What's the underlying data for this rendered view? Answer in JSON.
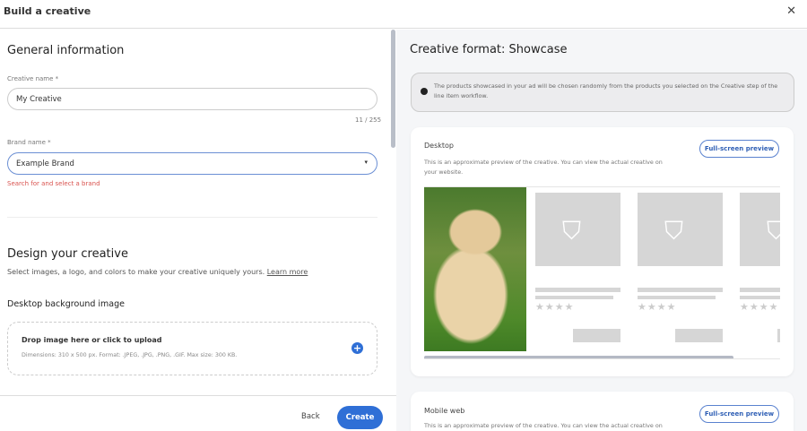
{
  "header": {
    "title": "Build a creative",
    "close_icon": "close-icon"
  },
  "general": {
    "title": "General information",
    "creative_name_label": "Creative name *",
    "creative_name_value": "My Creative",
    "char_count": "11 / 255",
    "brand_name_label": "Brand name *",
    "brand_name_value": "Example Brand",
    "brand_error": "Search for and select a brand"
  },
  "design": {
    "title": "Design your creative",
    "description": "Select images, a logo, and colors to make your creative uniquely yours.",
    "learn_more": "Learn more",
    "bg_image_title": "Desktop background image",
    "drop_title": "Drop image here or click to upload",
    "drop_hint": "Dimensions: 310 x 500 px. Format: .JPEG, .JPG, .PNG, .GIF. Max size: 300 KB."
  },
  "footer": {
    "back": "Back",
    "create": "Create"
  },
  "preview": {
    "title": "Creative format: Showcase",
    "info": "The products showcased in your ad will be chosen randomly from the products you selected on the Creative step of the line item workflow.",
    "desktop": {
      "title": "Desktop",
      "description": "This is an approximate preview of the creative. You can view the actual creative on your website.",
      "button": "Full-screen preview",
      "stars": "★★★★"
    },
    "mobile": {
      "title": "Mobile web",
      "description": "This is an approximate preview of the creative. You can view the actual creative on",
      "button": "Full-screen preview"
    }
  },
  "colors": {
    "accent": "#2f6fd6",
    "error": "#d9534f"
  }
}
